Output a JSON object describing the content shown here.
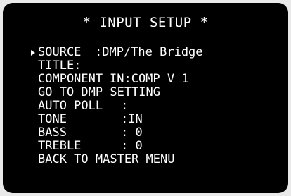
{
  "screen": {
    "title": "* INPUT SETUP *",
    "selected_index": 0,
    "colors": {
      "background": "#000000",
      "text": "#ffffff",
      "frame": "#e9e9e9"
    },
    "cursor_icon": "triangle-right-icon"
  },
  "menu": {
    "items": [
      {
        "label": "SOURCE",
        "value": ":DMP/The Bridge"
      },
      {
        "label": "TITLE:",
        "value": ""
      },
      {
        "label": "COMPONENT",
        "value": "IN:COMP V 1"
      },
      {
        "label": "GO TO DMP SETTING",
        "value": ""
      },
      {
        "label": "AUTO POLL",
        "value": ":"
      },
      {
        "label": "TONE",
        "value": ":IN"
      },
      {
        "label": "BASS",
        "value": ": 0"
      },
      {
        "label": "TREBLE",
        "value": ": 0"
      },
      {
        "label": "BACK TO MASTER MENU",
        "value": ""
      }
    ]
  }
}
